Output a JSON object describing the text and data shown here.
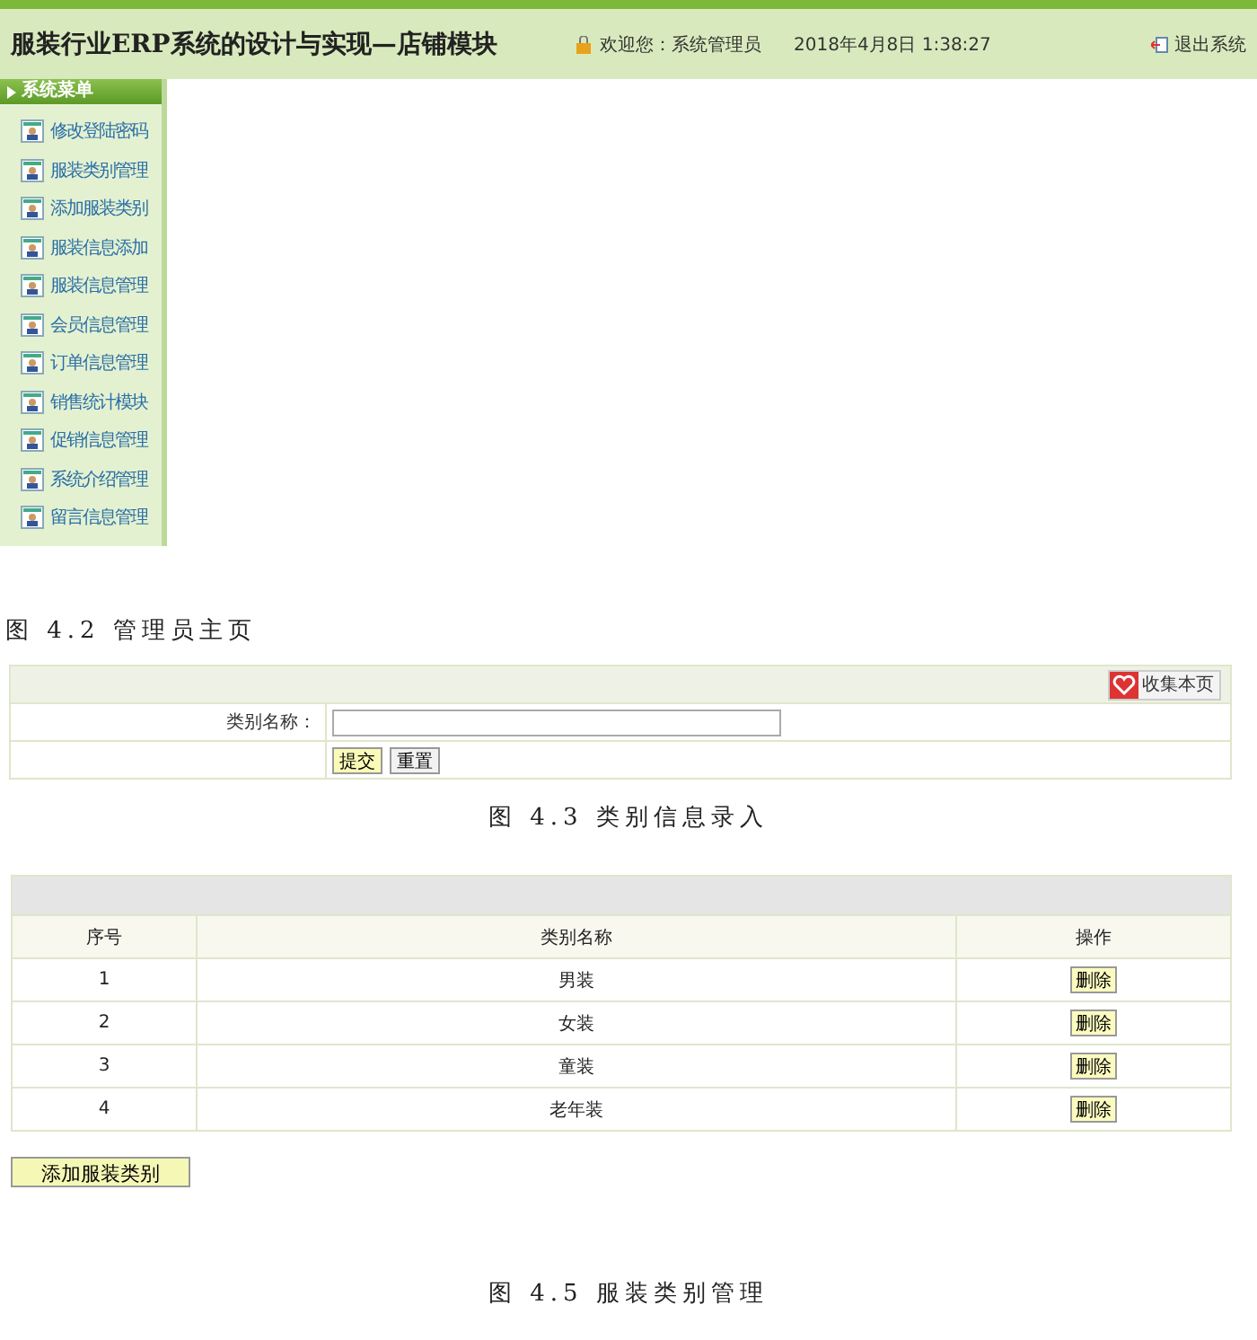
{
  "admin_home": {
    "title": "服装行业ERP系统的设计与实现—店铺模块",
    "welcome": "欢迎您：系统管理员",
    "datetime": "2018年4月8日  1:38:27",
    "logout": "退出系统",
    "menu_title": "系统菜单",
    "menu_items": [
      {
        "label": "修改登陆密码"
      },
      {
        "label": "服装类别管理"
      },
      {
        "label": "添加服装类别"
      },
      {
        "label": "服装信息添加"
      },
      {
        "label": "服装信息管理"
      },
      {
        "label": "会员信息管理"
      },
      {
        "label": "订单信息管理"
      },
      {
        "label": "销售统计模块"
      },
      {
        "label": "促销信息管理"
      },
      {
        "label": "系统介绍管理"
      },
      {
        "label": "留言信息管理"
      }
    ]
  },
  "caption_1": "图 4.2 管理员主页",
  "entry_form": {
    "bookmark": "收集本页",
    "field_label": "类别名称：",
    "buttons": [
      "提交",
      "重置"
    ]
  },
  "caption_2": "图 4.3 类别信息录入",
  "category_table": {
    "columns": [
      "序号",
      "类别名称",
      "操作"
    ],
    "rows": [
      {
        "index": "1",
        "name": "男装",
        "action": "删除"
      },
      {
        "index": "2",
        "name": "女装",
        "action": "删除"
      },
      {
        "index": "3",
        "name": "童装",
        "action": "删除"
      },
      {
        "index": "4",
        "name": "老年装",
        "action": "删除"
      }
    ],
    "add_button": "添加服装类别"
  },
  "caption_3": "图 4.5 服装类别管理"
}
